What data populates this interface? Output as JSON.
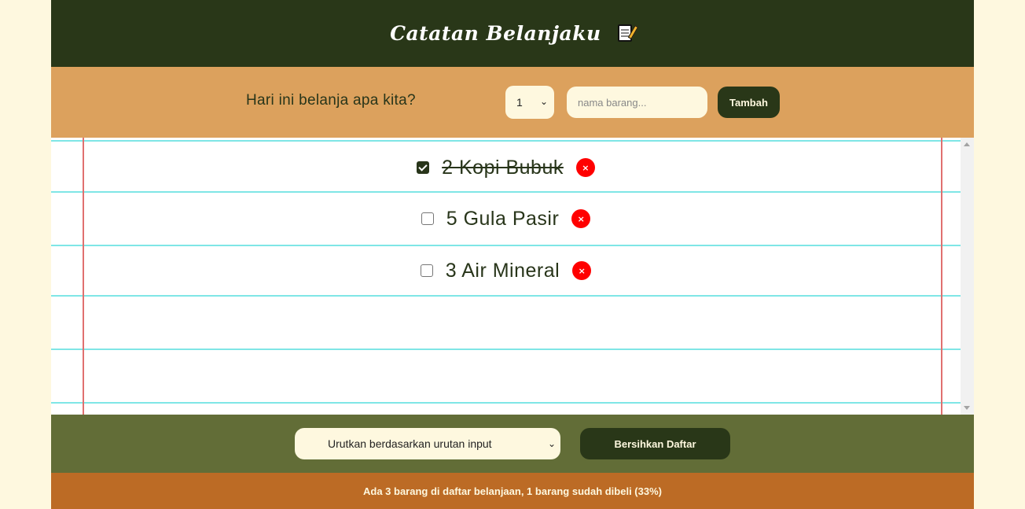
{
  "header": {
    "title": "Catatan Belanjaku",
    "icon": "memo-icon"
  },
  "add_form": {
    "question": "Hari ini belanja apa kita?",
    "quantity_value": "1",
    "name_placeholder": "nama barang...",
    "add_label": "Tambah"
  },
  "items": [
    {
      "text": "2 Kopi Bubuk",
      "checked": true
    },
    {
      "text": "5 Gula Pasir",
      "checked": false
    },
    {
      "text": "3 Air Mineral",
      "checked": false
    }
  ],
  "delete_symbol": "×",
  "controls": {
    "sort_value": "Urutkan berdasarkan urutan input",
    "clear_label": "Bersihkan Daftar"
  },
  "footer": {
    "stats": "Ada 3 barang di daftar belanjaan, 1 barang sudah dibeli (33%)"
  },
  "colors": {
    "header_bg": "#293718",
    "form_bg": "#dca15d",
    "controls_bg": "#626d37",
    "footer_bg": "#bc6b25",
    "page_bg": "#fef8df",
    "delete": "#ff0000"
  }
}
